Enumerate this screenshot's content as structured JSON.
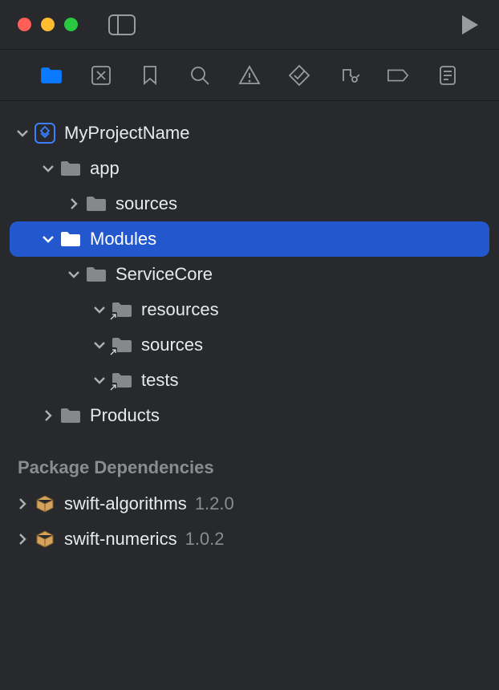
{
  "project": {
    "name": "MyProjectName"
  },
  "tree": {
    "app": "app",
    "app_sources": "sources",
    "modules": "Modules",
    "servicecore": "ServiceCore",
    "sc_resources": "resources",
    "sc_sources": "sources",
    "sc_tests": "tests",
    "products": "Products"
  },
  "sections": {
    "dependencies": "Package Dependencies"
  },
  "dependencies": [
    {
      "name": "swift-algorithms",
      "version": "1.2.0"
    },
    {
      "name": "swift-numerics",
      "version": "1.0.2"
    }
  ],
  "colors": {
    "selection": "#2357ce",
    "folder": "#86888a",
    "folder_selected": "#ffffff",
    "project_icon": "#0a7aff",
    "package": "#d6a35c"
  }
}
